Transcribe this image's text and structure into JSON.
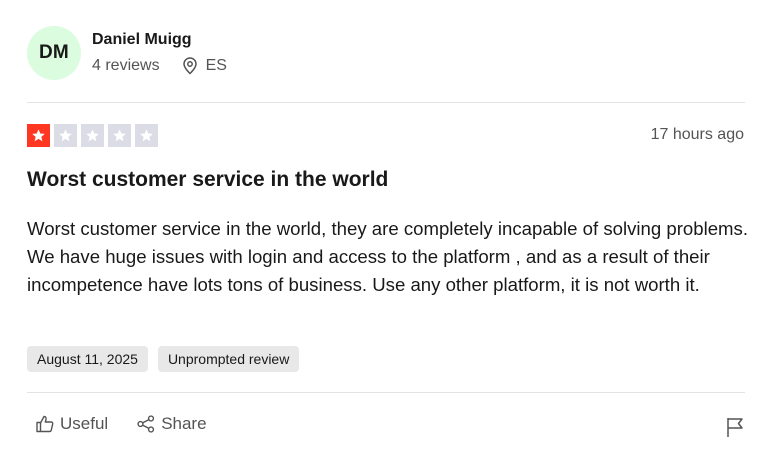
{
  "consumer": {
    "initials": "DM",
    "avatar_color": "#dcfce0",
    "name": "Daniel Muigg",
    "reviews_count": "4 reviews",
    "country": "ES",
    "location_icon": "location-pin-icon"
  },
  "review": {
    "rating": 1,
    "max_rating": 5,
    "star_filled_color": "#ff3722",
    "star_empty_color": "#dcdce6",
    "time_ago": "17 hours ago",
    "title": "Worst customer service in the world",
    "body": "Worst customer service in the world, they are completely incapable of solving problems. We have huge issues with login and access to the platform , and as a result of their incompetence have lots tons of business. Use any other platform, it is not worth it.",
    "experience_date": "August 11, 2025",
    "review_type": "Unprompted review"
  },
  "actions": {
    "useful_label": "Useful",
    "useful_icon": "thumbs-up-icon",
    "share_label": "Share",
    "share_icon": "share-icon",
    "report_icon": "flag-icon"
  }
}
